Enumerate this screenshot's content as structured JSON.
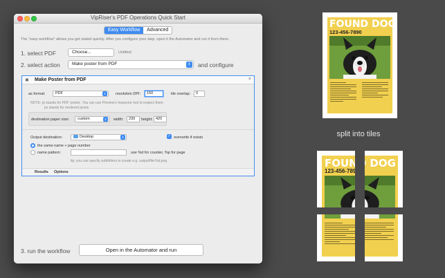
{
  "window": {
    "title": "VipRiser's PDF Operations Quick Start",
    "tabs": [
      {
        "label": "Easy Workflow",
        "active": true
      },
      {
        "label": "Advanced",
        "active": false
      }
    ],
    "intro": "The \"easy workflow\" allows you get stated quickly. After you configure your step, open it the Automator and run it from there."
  },
  "steps": {
    "select_pdf": {
      "label": "1. select PDF",
      "button": "Choose...",
      "file": "Untitled"
    },
    "select_action": {
      "label": "2. select action",
      "value": "Make poster from PDF",
      "suffix": "and configure"
    },
    "run": {
      "label": "3. run the workflow",
      "button": "Open in the Automator and run"
    }
  },
  "panel": {
    "title": "Make Poster from PDF",
    "as_format": {
      "label": "as format:",
      "value": "PDF"
    },
    "resolution": {
      "label": "resolution DPI:",
      "value": "150"
    },
    "overlap": {
      "label": "tile overlap:",
      "value": "0"
    },
    "note_line1": "NOTE: pt stands for PDF 'points'. You can use Preview's Inspector tool to inspect them.",
    "note_line2": "px stands for rendered pixels",
    "paper_size": {
      "label": "destination paper size:",
      "value": "custom"
    },
    "width": {
      "label": "width:",
      "value": "230"
    },
    "height": {
      "label": "height:",
      "value": "420"
    },
    "output_destination": {
      "label": "Output destination:",
      "value": "Desktop"
    },
    "overwrite": {
      "label": "overwrite if exists",
      "checked": true
    },
    "name_same": {
      "label": "the same name + page number",
      "selected": true
    },
    "name_pattern": {
      "label": "name pattern:",
      "selected": false,
      "value": "",
      "hint": "use %d for counter, %p for page"
    },
    "tip": "tip: you can specify subfolders to create e.g. output/file-%d.png",
    "tabs": [
      "Results",
      "Options"
    ]
  },
  "posters": {
    "title": "FOUND DOG",
    "phone": "123-456-7890",
    "caption": "split into tiles"
  },
  "colors": {
    "accent": "#3f8cf2",
    "poster_yellow": "#f2d04f",
    "background": "#4a4a4a"
  }
}
